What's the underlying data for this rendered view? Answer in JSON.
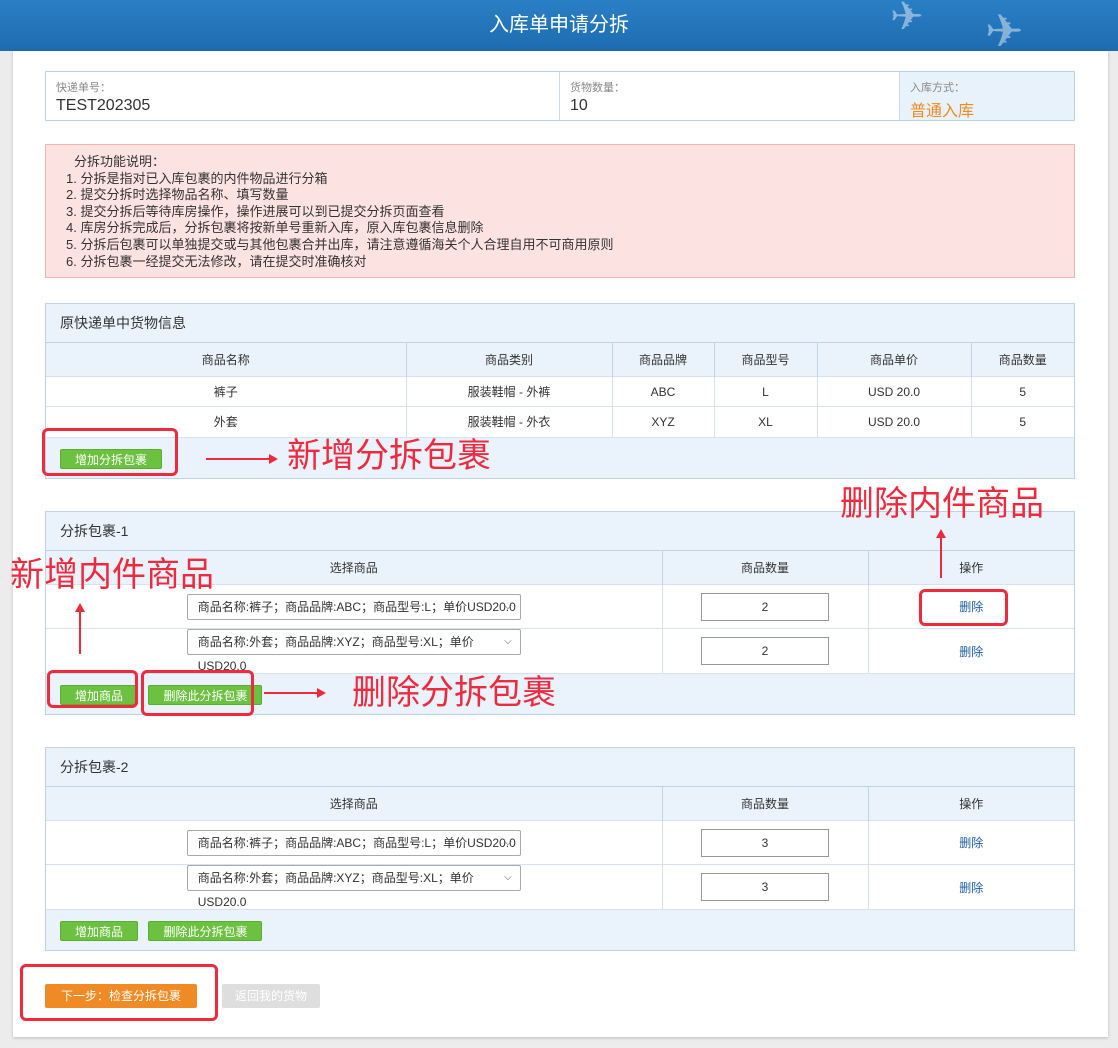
{
  "header": {
    "title": "入库单申请分拆"
  },
  "info": {
    "tracking_label": "快递单号：",
    "tracking_value": "TEST202305",
    "qty_label": "货物数量：",
    "qty_value": "10",
    "method_label": "入库方式：",
    "method_value": "普通入库"
  },
  "notice": {
    "lines": [
      "分拆功能说明：",
      "1. 分拆是指对已入库包裹的内件物品进行分箱",
      "2. 提交分拆时选择物品名称、填写数量",
      "3. 提交分拆后等待库房操作，操作进展可以到已提交分拆页面查看",
      "4. 库房分拆完成后，分拆包裹将按新单号重新入库，原入库包裹信息删除",
      "5. 分拆后包裹可以单独提交或与其他包裹合并出库，请注意遵循海关个人合理自用不可商用原则",
      "6. 分拆包裹一经提交无法修改，请在提交时准确核对"
    ]
  },
  "original": {
    "title": "原快递单中货物信息",
    "columns": [
      "商品名称",
      "商品类别",
      "商品品牌",
      "商品型号",
      "商品单价",
      "商品数量"
    ],
    "rows": [
      [
        "裤子",
        "服装鞋帽 - 外裤",
        "ABC",
        "L",
        "USD 20.0",
        "5"
      ],
      [
        "外套",
        "服装鞋帽 - 外衣",
        "XYZ",
        "XL",
        "USD 20.0",
        "5"
      ]
    ],
    "add_button": "增加分拆包裹"
  },
  "packages": [
    {
      "title": "分拆包裹-1",
      "columns": [
        "选择商品",
        "商品数量",
        "操作"
      ],
      "items": [
        {
          "select": "商品名称:裤子；商品品牌:ABC；商品型号:L；单价USD20.0",
          "qty": "2",
          "action": "删除"
        },
        {
          "select": "商品名称:外套；商品品牌:XYZ；商品型号:XL；单价USD20.0",
          "qty": "2",
          "action": "删除"
        }
      ],
      "add_item": "增加商品",
      "delete_pkg": "删除此分拆包裹"
    },
    {
      "title": "分拆包裹-2",
      "columns": [
        "选择商品",
        "商品数量",
        "操作"
      ],
      "items": [
        {
          "select": "商品名称:裤子；商品品牌:ABC；商品型号:L；单价USD20.0",
          "qty": "3",
          "action": "删除"
        },
        {
          "select": "商品名称:外套；商品品牌:XYZ；商品型号:XL；单价USD20.0",
          "qty": "3",
          "action": "删除"
        }
      ],
      "add_item": "增加商品",
      "delete_pkg": "删除此分拆包裹"
    }
  ],
  "footer": {
    "next": "下一步：检查分拆包裹",
    "back": "返回我的货物"
  },
  "annotations": {
    "add_package": "新增分拆包裹",
    "delete_item": "删除内件商品",
    "add_item": "新增内件商品",
    "delete_package": "删除分拆包裹"
  },
  "colors": {
    "header": "#1d6cb2",
    "accent_orange": "#f08a24",
    "button_green": "#6cc240",
    "annotation_red": "#ee2a3f",
    "notice_bg": "#fde2e2"
  }
}
